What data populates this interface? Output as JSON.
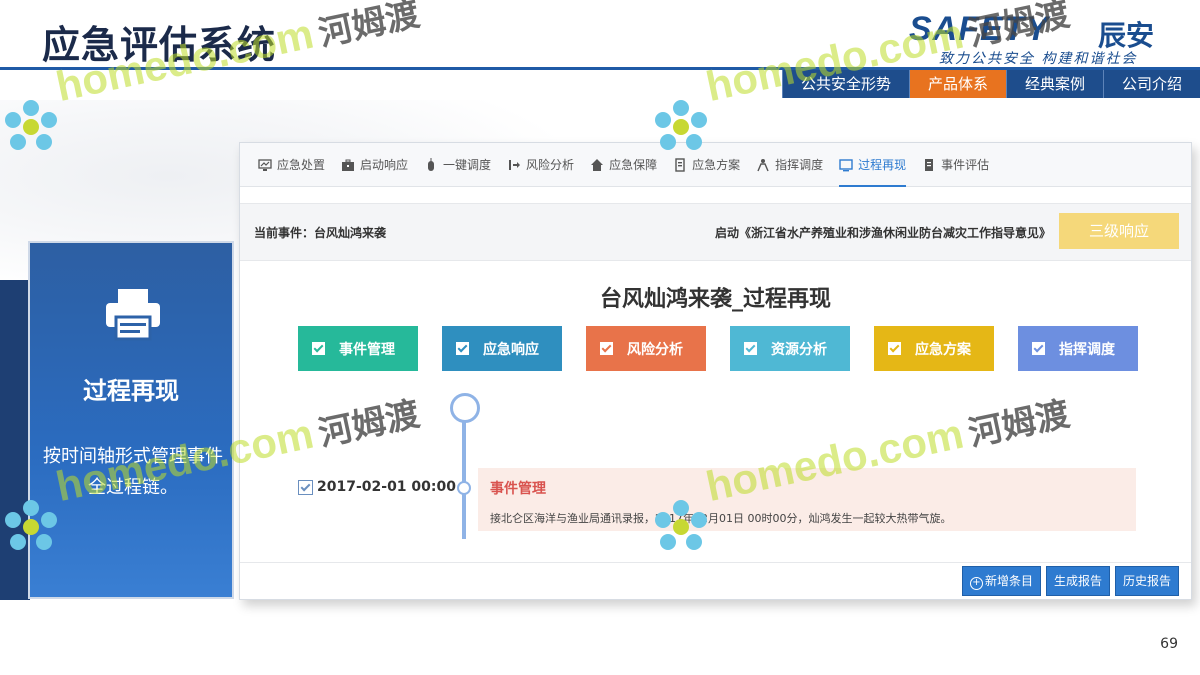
{
  "slide": {
    "title": "应急评估系统",
    "page_number": "69"
  },
  "logo": {
    "brand": "SAFETY",
    "brand_cn": "辰安",
    "slogan": "致力公共安全  构建和谐社会"
  },
  "top_nav": [
    "公共安全形势",
    "产品体系",
    "经典案例",
    "公司介绍"
  ],
  "top_nav_active": 1,
  "feature_card": {
    "title": "过程再现",
    "description": "按时间轴形式管理事件全过程链。"
  },
  "app": {
    "tabs": [
      {
        "label": "应急处置",
        "icon": "monitor-icon"
      },
      {
        "label": "启动响应",
        "icon": "briefcase-icon"
      },
      {
        "label": "一键调度",
        "icon": "mouse-icon"
      },
      {
        "label": "风险分析",
        "icon": "signal-icon"
      },
      {
        "label": "应急保障",
        "icon": "home-icon"
      },
      {
        "label": "应急方案",
        "icon": "plan-icon"
      },
      {
        "label": "指挥调度",
        "icon": "people-icon"
      },
      {
        "label": "过程再现",
        "icon": "screen-icon"
      },
      {
        "label": "事件评估",
        "icon": "document-icon"
      }
    ],
    "active_tab": 7,
    "current_event": "当前事件：台风灿鸿来袭",
    "launched_doc": "启动《浙江省水产养殖业和涉渔休闲业防台减灾工作指导意见》",
    "level_button": "三级响应",
    "heading": "台风灿鸿来袭_过程再现",
    "modules": [
      {
        "label": "事件管理",
        "color": "#26b99a"
      },
      {
        "label": "应急响应",
        "color": "#2f8fbf"
      },
      {
        "label": "风险分析",
        "color": "#e8734a"
      },
      {
        "label": "资源分析",
        "color": "#4fb8d4"
      },
      {
        "label": "应急方案",
        "color": "#e5b716"
      },
      {
        "label": "指挥调度",
        "color": "#6d8fe0"
      }
    ],
    "timeline": {
      "date": "2017-02-01 00:00",
      "event_title": "事件管理",
      "event_text": "接北仑区海洋与渔业局通讯录报，2017年02月01日 00时00分，灿鸿发生一起较大热带气旋。"
    },
    "footer_buttons": [
      "新增条目",
      "生成报告",
      "历史报告"
    ]
  },
  "watermark": {
    "en": "homedo.com",
    "cn": "河姆渡"
  },
  "colors": {
    "nav_bg": "#1e4d8c",
    "nav_active": "#e8731f",
    "card_blue": "#2b6cc0",
    "accent": "#2e7bd0"
  }
}
